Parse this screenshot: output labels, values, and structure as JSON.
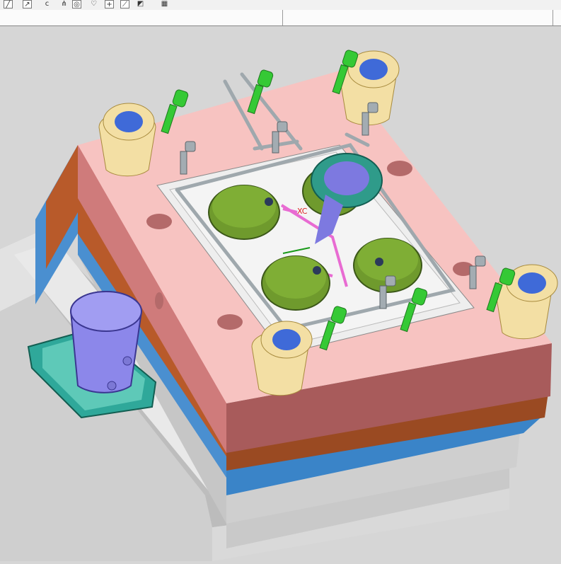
{
  "toolbar": {
    "icons": [
      {
        "name": "line-tool-icon",
        "glyph": "╱"
      },
      {
        "name": "arrow-tool-icon",
        "glyph": "↗"
      },
      {
        "name": "arc-tool-icon",
        "glyph": "ϲ"
      },
      {
        "name": "snap-point-icon",
        "glyph": "⋔"
      },
      {
        "name": "circle-center-icon",
        "glyph": "◎"
      },
      {
        "name": "heart-curve-icon",
        "glyph": "♡"
      },
      {
        "name": "add-point-icon",
        "glyph": "+"
      },
      {
        "name": "trim-tool-icon",
        "glyph": "⟋"
      },
      {
        "name": "view-cube-icon",
        "glyph": "◩"
      },
      {
        "name": "grid-settings-icon",
        "glyph": "▦"
      }
    ]
  },
  "statusbar": {
    "left_text": "",
    "right_text": ""
  },
  "viewport": {
    "axis_label": "XC",
    "colors": {
      "background": "#d6d6d6",
      "plate_top": "#f7c3c1",
      "plate_side": "#d97b7b",
      "plate_front": "#a85b5b",
      "brown_layer": "#b85a2a",
      "blue_layer": "#4a8fd0",
      "gray_base": "#c8c8c8",
      "cavity_green": "#6f9a2d",
      "guide_bushing": "#f3dfa4",
      "bolt_green": "#35c935",
      "cooling_pipe": "#9fa8ad",
      "motor_purple": "#8c87ea",
      "motor_teal": "#2fa89a",
      "runner_pink": "#e86bd2"
    }
  }
}
